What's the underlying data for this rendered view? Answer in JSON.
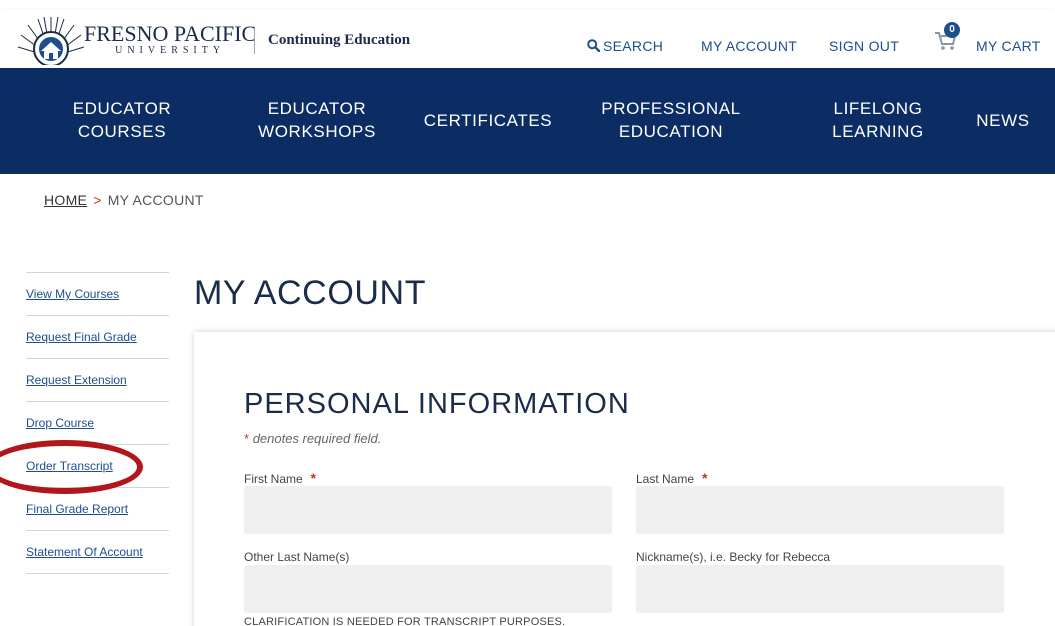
{
  "header": {
    "logo_main": "FRESNO PACIFIC",
    "logo_sub": "UNIVERSITY",
    "subtitle": "Continuing Education",
    "search": "SEARCH",
    "my_account": "MY ACCOUNT",
    "sign_out": "SIGN OUT",
    "cart_count": "0",
    "my_cart": "MY CART"
  },
  "nav": [
    {
      "label": "EDUCATOR\nCOURSES"
    },
    {
      "label": "EDUCATOR\nWORKSHOPS"
    },
    {
      "label": "CERTIFICATES"
    },
    {
      "label": "PROFESSIONAL\nEDUCATION"
    },
    {
      "label": "LIFELONG\nLEARNING"
    },
    {
      "label": "NEWS"
    }
  ],
  "breadcrumb": {
    "home": "HOME",
    "separator": ">",
    "current": "MY ACCOUNT"
  },
  "sidebar": {
    "items": [
      {
        "label": "View My Courses"
      },
      {
        "label": "Request Final Grade"
      },
      {
        "label": "Request Extension"
      },
      {
        "label": "Drop Course"
      },
      {
        "label": "Order Transcript"
      },
      {
        "label": "Final Grade Report"
      },
      {
        "label": "Statement Of Account"
      }
    ]
  },
  "main": {
    "title": "MY ACCOUNT",
    "section_title": "PERSONAL INFORMATION",
    "required_star": "*",
    "required_note": "denotes required field.",
    "fields": {
      "first_name": {
        "label": "First Name",
        "value": ""
      },
      "last_name": {
        "label": "Last Name",
        "value": ""
      },
      "other_last_names": {
        "label": "Other Last Name(s)",
        "value": ""
      },
      "nicknames": {
        "label": "Nickname(s), i.e. Becky for Rebecca",
        "value": ""
      }
    },
    "clarification": "CLARIFICATION IS NEEDED FOR TRANSCRIPT PURPOSES."
  },
  "colors": {
    "navy": "#0c2d63",
    "link": "#1f4e8c",
    "required": "#c0392b",
    "highlight": "#b0161c"
  }
}
